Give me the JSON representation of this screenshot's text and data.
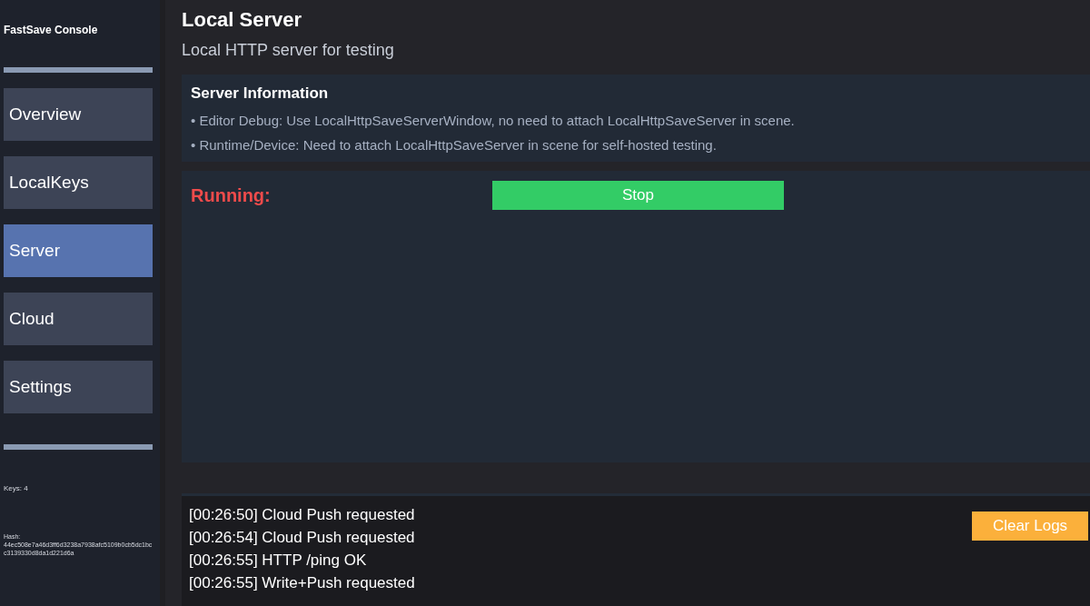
{
  "sidebar": {
    "title": "FastSave Console",
    "items": [
      {
        "label": "Overview",
        "selected": false
      },
      {
        "label": "LocalKeys",
        "selected": false
      },
      {
        "label": "Server",
        "selected": true
      },
      {
        "label": "Cloud",
        "selected": false
      },
      {
        "label": "Settings",
        "selected": false
      }
    ],
    "keys": "Keys: 4",
    "hash_label": "Hash:",
    "hash": "44ec508e7a46d3ff6d3238a7938afc5109b0cb5dc1bcc3139330d8da1d221d6a"
  },
  "page": {
    "title": "Local Server",
    "subtitle": "Local HTTP server for testing"
  },
  "info": {
    "title": "Server Information",
    "lines": [
      "• Editor Debug: Use LocalHttpSaveServerWindow, no need to attach LocalHttpSaveServer in scene.",
      "• Runtime/Device: Need to attach LocalHttpSaveServer in scene for self-hosted testing."
    ]
  },
  "server": {
    "status": "Running:",
    "button": "Stop"
  },
  "logs": {
    "lines": [
      "[00:26:50] Cloud Push requested",
      "[00:26:54] Cloud Push requested",
      "[00:26:55] HTTP /ping OK",
      "[00:26:55] Write+Push requested"
    ],
    "button": "Clear Logs"
  }
}
